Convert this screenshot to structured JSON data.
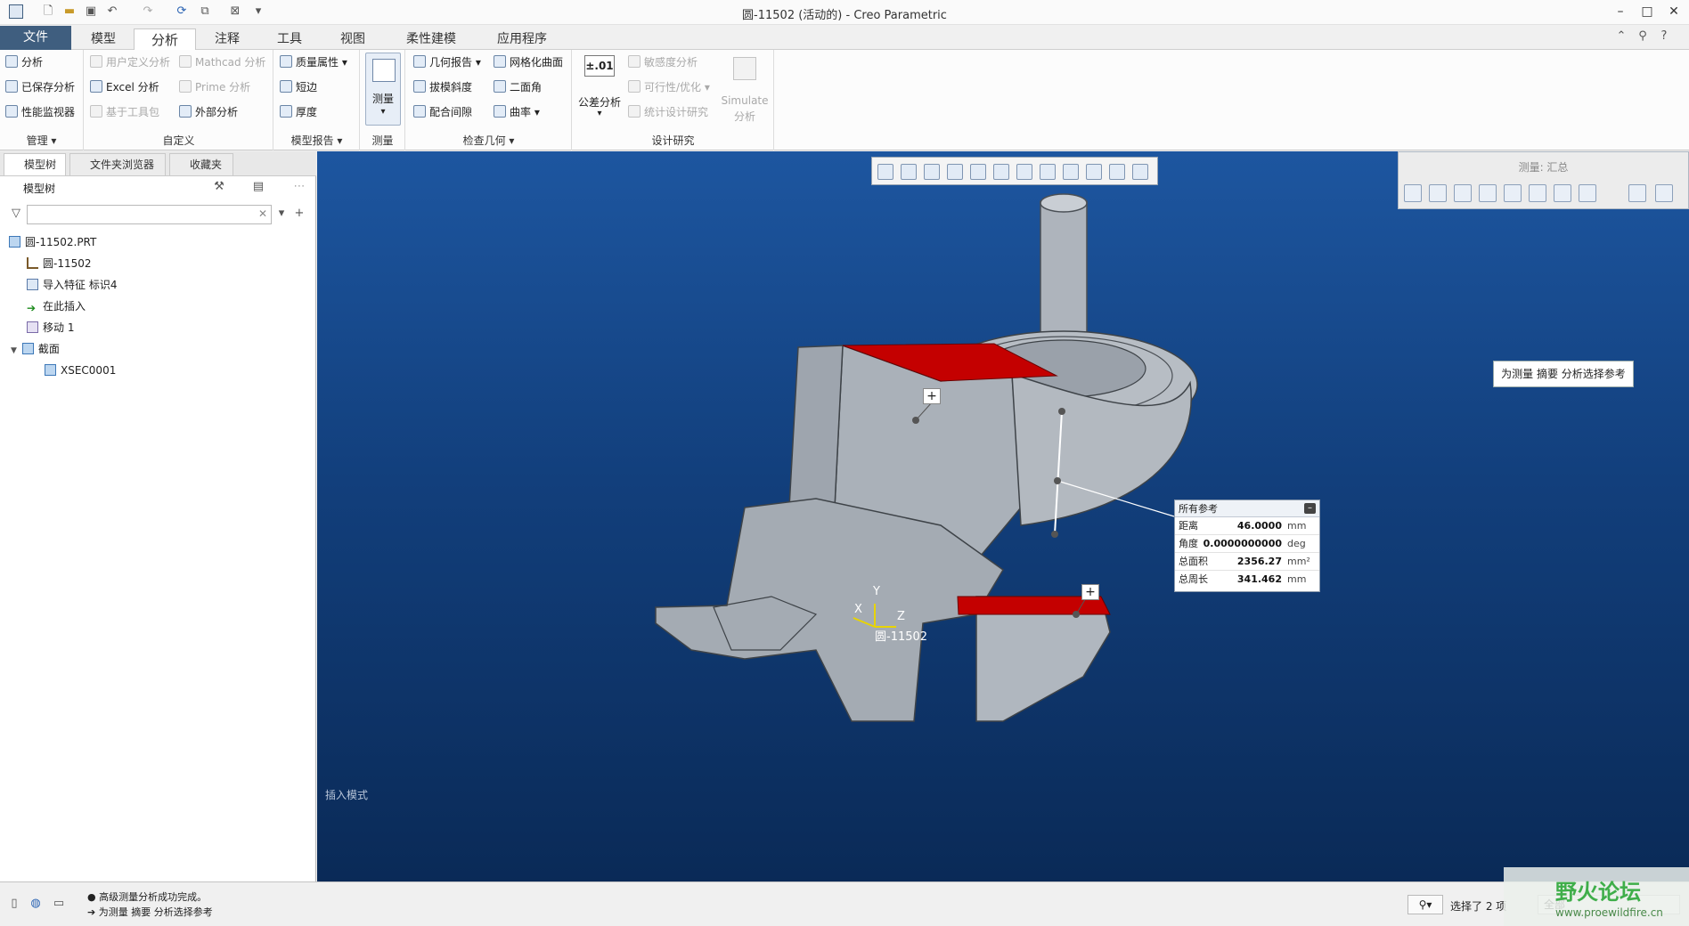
{
  "window": {
    "title": "圆-11502 (活动的) - Creo Parametric",
    "controls": [
      "–",
      "□",
      "✕"
    ]
  },
  "tabs": [
    "文件",
    "模型",
    "分析",
    "注释",
    "工具",
    "视图",
    "柔性建模",
    "应用程序"
  ],
  "ribbon": {
    "groups": {
      "manage": {
        "label": "管理 ▾",
        "items": [
          "分析",
          "已保存分析",
          "性能监视器"
        ]
      },
      "custom": {
        "label": "自定义",
        "items": [
          "用户定义分析",
          "Excel 分析",
          "基于工具包",
          "Mathcad 分析",
          "Prime 分析",
          "外部分析"
        ]
      },
      "model_report": {
        "label": "模型报告 ▾",
        "items": [
          "质量属性",
          "短边",
          "厚度"
        ]
      },
      "measure": {
        "label": "测量",
        "button": "测量"
      },
      "inspect": {
        "label": "检查几何 ▾",
        "items": [
          "几何报告",
          "拔模斜度",
          "配合间隙",
          "网格化曲面",
          "二面角",
          "曲率"
        ]
      },
      "design_study": {
        "label": "设计研究",
        "tolerance_icon": "±.01",
        "tolerance_label": "公差分析",
        "items": [
          "敏感度分析",
          "可行性/优化",
          "统计设计研究"
        ],
        "simulate": "Simulate",
        "simulate_sub": "分析"
      }
    }
  },
  "left_tabs": [
    "模型树",
    "文件夹浏览器",
    "收藏夹"
  ],
  "model_tree": {
    "header": "模型树",
    "search_clear": "✕",
    "items": [
      {
        "label": "圆-11502.PRT",
        "icon": "part-icon"
      },
      {
        "label": "圆-11502",
        "icon": "csys-icon"
      },
      {
        "label": "导入特征 标识4",
        "icon": "import-feature-icon"
      },
      {
        "label": "在此插入",
        "icon": "insert-arrow-icon"
      },
      {
        "label": "移动 1",
        "icon": "move-icon"
      },
      {
        "label": "截面",
        "icon": "section-icon",
        "expander": "▼"
      },
      {
        "label": "XSEC0001",
        "icon": "xsec-icon"
      }
    ]
  },
  "viewport": {
    "insert_mode": "插入模式",
    "csys": {
      "x": "X",
      "y": "Y",
      "z": "Z",
      "name": "圆-11502"
    },
    "tooltip": "为测量 摘要 分析选择参考",
    "plus": "+"
  },
  "measure_panel": {
    "title": "测量: 汇总"
  },
  "measure_box": {
    "header": "所有参考",
    "collapse": "–",
    "rows": [
      {
        "key": "距离",
        "value": "46.0000",
        "unit": "mm"
      },
      {
        "key": "角度",
        "value": "0.0000000000",
        "unit": "deg"
      },
      {
        "key": "总面积",
        "value": "2356.27",
        "unit": "mm²"
      },
      {
        "key": "总周长",
        "value": "341.462",
        "unit": "mm"
      }
    ]
  },
  "status": {
    "messages": [
      "● 高级测量分析成功完成。",
      "➔ 为测量 摘要 分析选择参考"
    ],
    "selection": "选择了 2 项",
    "filter": "全部"
  },
  "watermark": {
    "title": "野火论坛",
    "url": "www.proewildfire.cn"
  },
  "colors": {
    "file_tab": "#3f5e7f",
    "viewport_top": "#1d56a0",
    "viewport_bottom": "#0a2a57",
    "highlight": "#c40000",
    "part": "#a9b0b8"
  }
}
